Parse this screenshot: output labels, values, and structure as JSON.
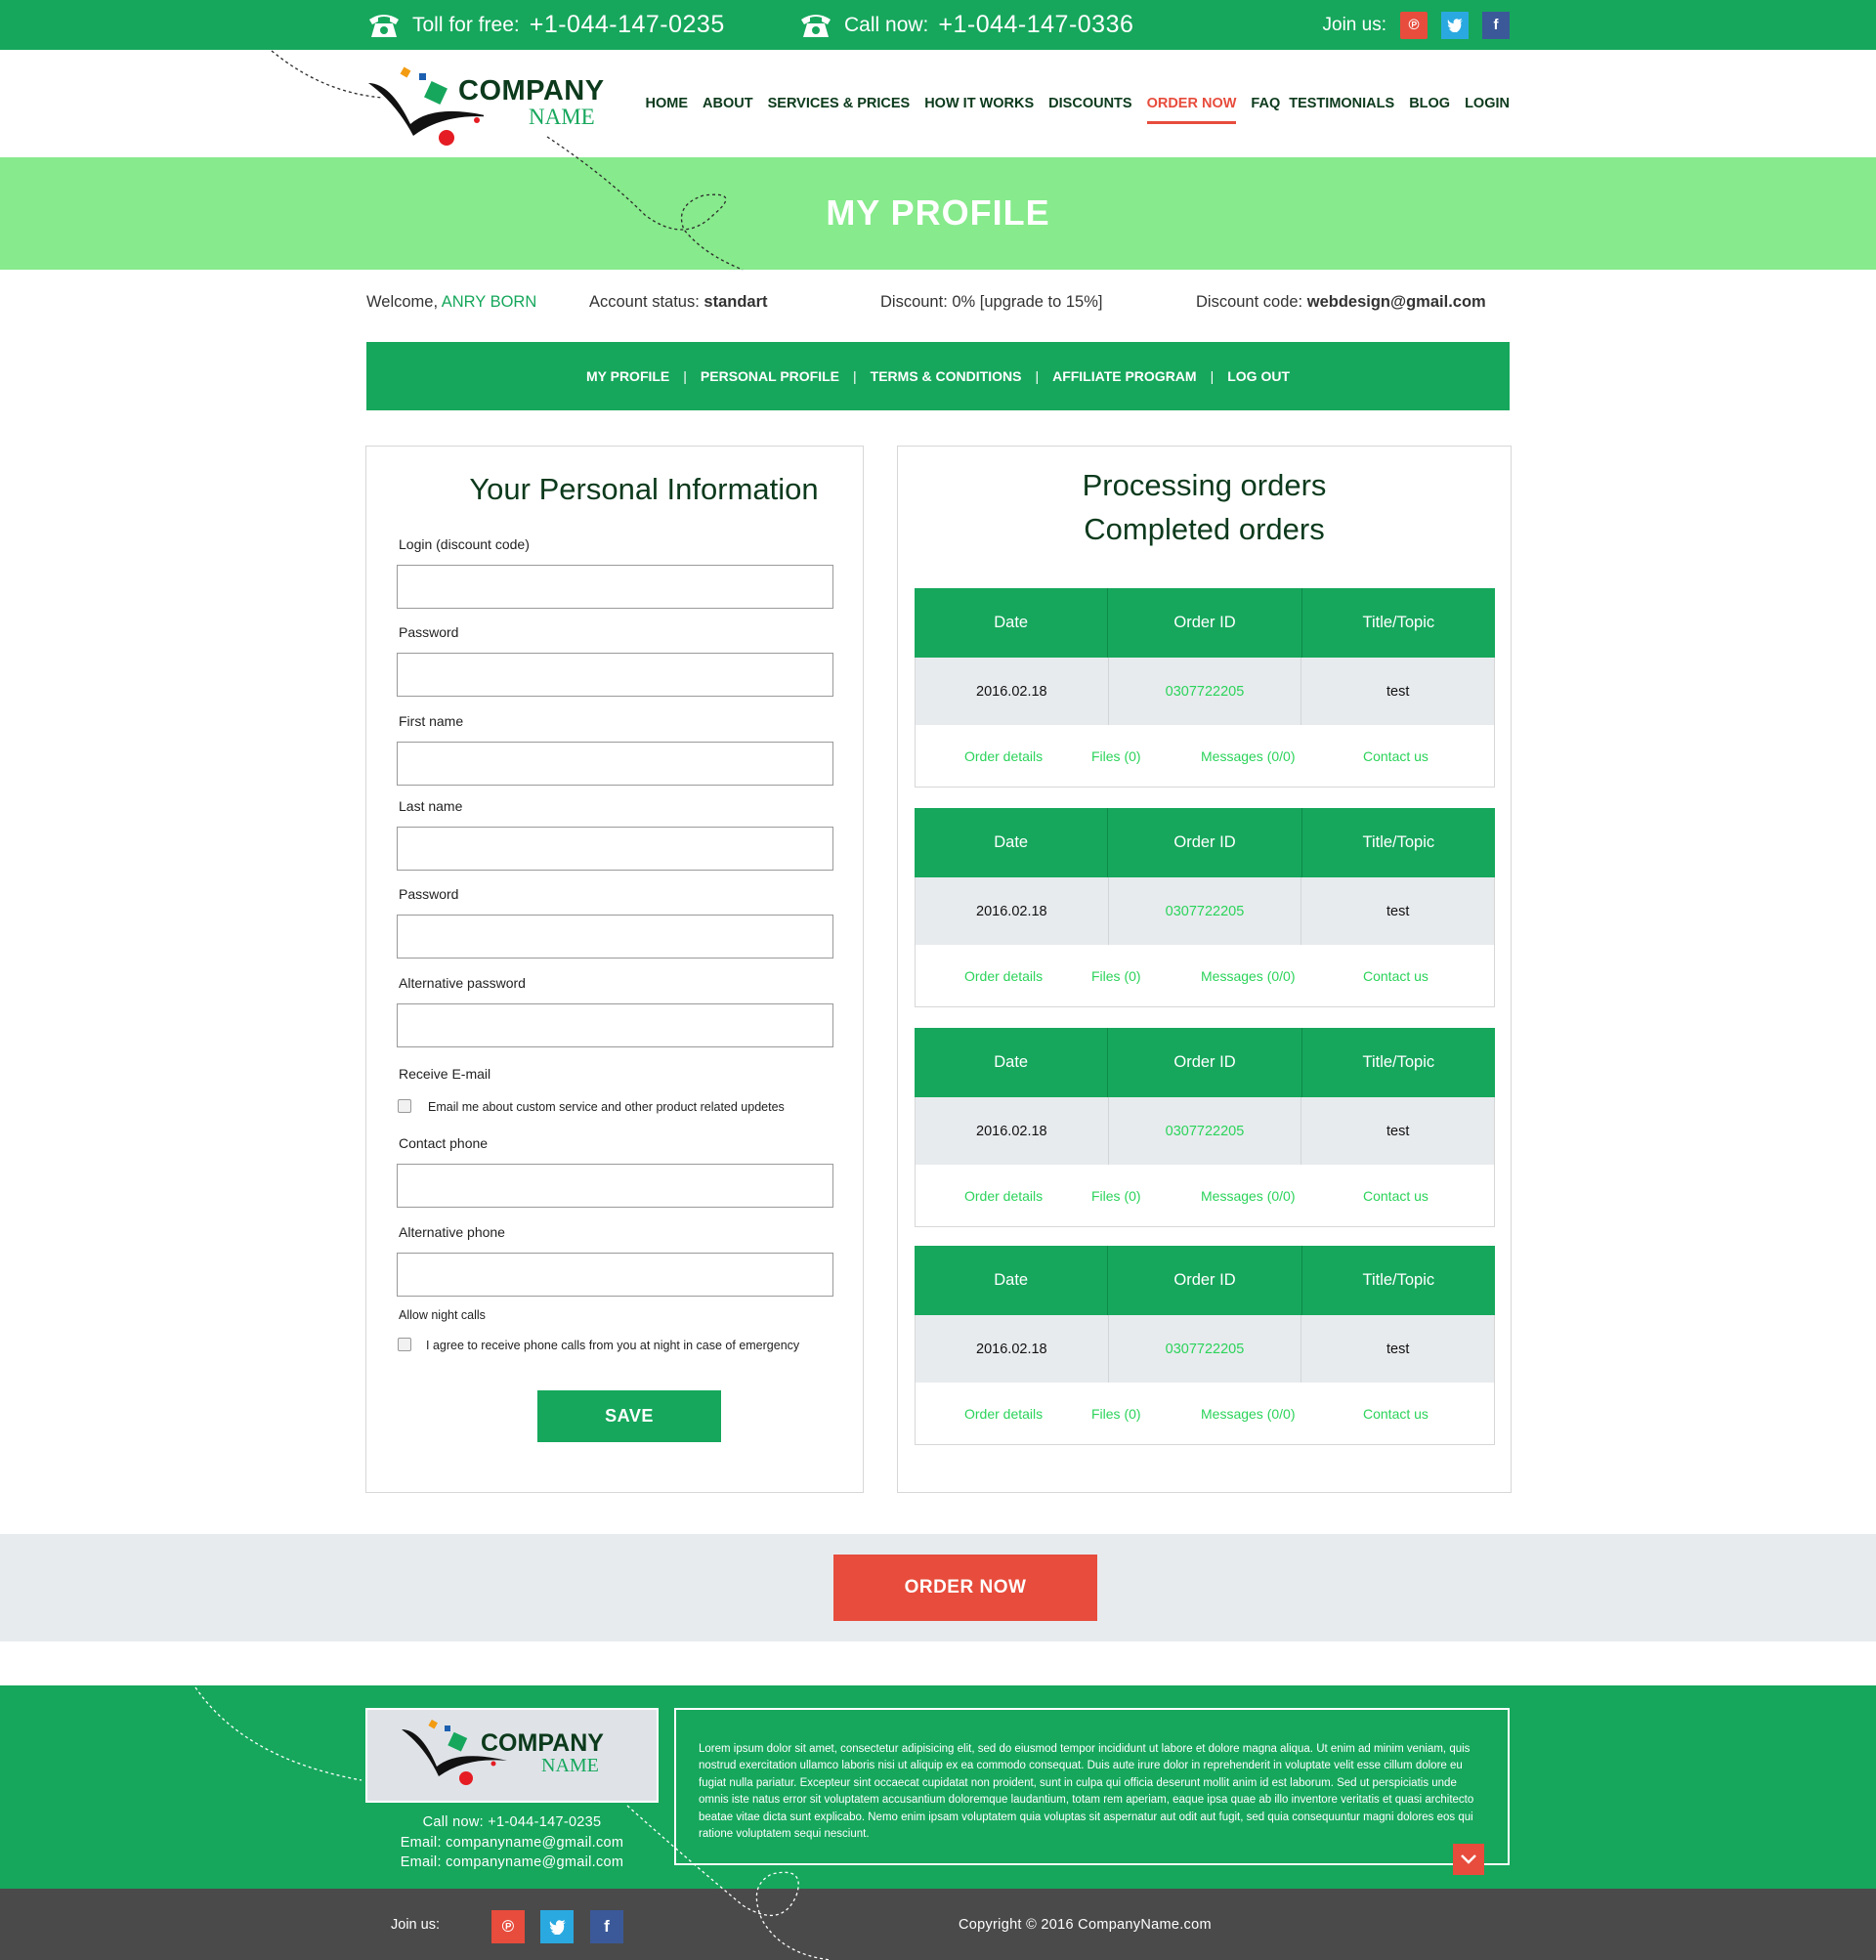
{
  "topbar": {
    "toll_label": "Toll for free:",
    "toll_number": "+1-044-147-0235",
    "call_label": "Call now:",
    "call_number": "+1-044-147-0336",
    "join_label": "Join us:"
  },
  "logo": {
    "line1": "COMPANY",
    "line2": "NAME"
  },
  "nav": {
    "items": [
      "HOME",
      "ABOUT",
      "SERVICES & PRICES",
      "HOW IT WORKS",
      "DISCOUNTS",
      "ORDER NOW",
      "FAQ",
      "TESTIMONIALS",
      "BLOG",
      "LOGIN"
    ],
    "active": "ORDER NOW"
  },
  "banner": {
    "title": "MY PROFILE"
  },
  "info": {
    "welcome_label": "Welcome,",
    "user_name": "ANRY BORN",
    "status_label": "Account status:",
    "status_value": "standart",
    "discount_text": "Discount: 0% [upgrade to 15%]",
    "code_label": "Discount code:",
    "code_value": "webdesign@gmail.com"
  },
  "subnav": [
    "MY PROFILE",
    "PERSONAL PROFILE",
    "TERMS & CONDITIONS",
    "AFFILIATE PROGRAM",
    "LOG OUT"
  ],
  "personal": {
    "title": "Your Personal Information",
    "fields": {
      "login": "Login (discount code)",
      "password": "Password",
      "first_name": "First name",
      "last_name": "Last name",
      "password2": "Password",
      "alt_password": "Alternative password",
      "receive_email": "Receive E-mail",
      "email_check": "Email me about custom service and other product related updetes",
      "contact_phone": "Contact phone",
      "alt_phone": "Alternative phone",
      "night_calls": "Allow night calls",
      "night_check": "I agree to receive phone calls from you at night in case of emergency"
    },
    "save": "SAVE"
  },
  "orders": {
    "title1": "Processing orders",
    "title2": "Completed orders",
    "headers": [
      "Date",
      "Order ID",
      "Title/Topic"
    ],
    "rows": [
      {
        "date": "2016.02.18",
        "id": "0307722205",
        "topic": "test"
      },
      {
        "date": "2016.02.18",
        "id": "0307722205",
        "topic": "test"
      },
      {
        "date": "2016.02.18",
        "id": "0307722205",
        "topic": "test"
      },
      {
        "date": "2016.02.18",
        "id": "0307722205",
        "topic": "test"
      }
    ],
    "links": {
      "details": "Order details",
      "files": "Files (0)",
      "messages": "Messages (0/0)",
      "contact": "Contact us"
    }
  },
  "order_now": "ORDER NOW",
  "footer": {
    "call": "Call now: +1-044-147-0235",
    "email1": "Email: companyname@gmail.com",
    "email2": "Email: companyname@gmail.com",
    "lorem": "Lorem ipsum dolor sit amet, consectetur adipisicing elit, sed do eiusmod tempor incididunt ut labore et dolore magna aliqua. Ut enim ad minim veniam, quis nostrud exercitation ullamco laboris nisi ut aliquip ex ea commodo consequat. Duis aute irure dolor in reprehenderit in voluptate velit esse cillum dolore eu fugiat nulla pariatur. Excepteur sint occaecat cupidatat non proident, sunt in culpa qui officia deserunt mollit anim id est laborum. Sed ut perspiciatis unde omnis iste natus error sit voluptatem accusantium doloremque laudantium, totam rem aperiam, eaque ipsa quae ab illo inventore veritatis et quasi architecto beatae vitae dicta sunt explicabo. Nemo enim ipsam voluptatem quia voluptas sit aspernatur aut odit aut fugit, sed quia consequuntur magni dolores eos qui ratione voluptatem sequi nesciunt.",
    "join_label": "Join us:",
    "copyright": "Copyright © 2016 CompanyName.com"
  },
  "colors": {
    "primary_green": "#16a75c",
    "light_green": "#87ea8c",
    "accent_red": "#e74c3c",
    "dark_text": "#0c3a1c",
    "link_green": "#2bd35a"
  },
  "icons": [
    "phone-icon",
    "pinterest-icon",
    "twitter-icon",
    "facebook-icon",
    "chevron-down-icon"
  ]
}
